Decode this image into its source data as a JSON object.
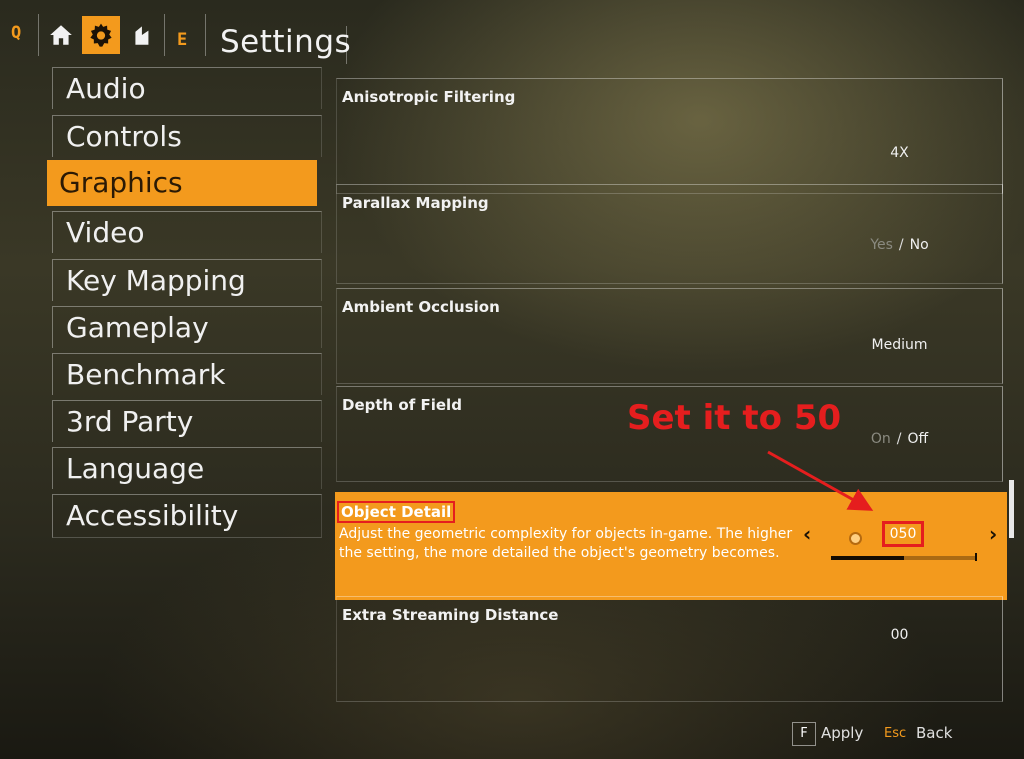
{
  "topbar": {
    "left_key": "Q",
    "right_key": "E",
    "icons": [
      "home-icon",
      "gear-icon",
      "inventory-icon"
    ],
    "title": "Settings"
  },
  "sidebar": {
    "items": [
      {
        "label": "Audio"
      },
      {
        "label": "Controls"
      },
      {
        "label": "Graphics"
      },
      {
        "label": "Video"
      },
      {
        "label": "Key Mapping"
      },
      {
        "label": "Gameplay"
      },
      {
        "label": "Benchmark"
      },
      {
        "label": "3rd Party"
      },
      {
        "label": "Language"
      },
      {
        "label": "Accessibility"
      }
    ],
    "active_index": 2
  },
  "settings": {
    "anisotropic": {
      "label": "Anisotropic Filtering",
      "value": "4X"
    },
    "parallax": {
      "label": "Parallax Mapping",
      "option_on": "Yes",
      "separator": "/",
      "option_off": "No"
    },
    "ambient": {
      "label": "Ambient Occlusion",
      "value": "Medium"
    },
    "dof": {
      "label": "Depth of Field",
      "option_on": "On",
      "separator": "/",
      "option_off": "Off"
    },
    "object_detail": {
      "label": "Object Detail",
      "description": "Adjust the geometric complexity for objects in-game. The higher the setting, the more detailed the object's geometry becomes.",
      "value": "050",
      "level_fraction": 0.5
    },
    "streaming": {
      "label": "Extra Streaming Distance",
      "value": "00"
    }
  },
  "annotation": {
    "text": "Set it to 50"
  },
  "footer": {
    "apply_key": "F",
    "apply_label": "Apply",
    "back_key": "Esc",
    "back_label": "Back"
  },
  "colors": {
    "accent": "#f39a1d",
    "annotation": "#e51e1e"
  }
}
